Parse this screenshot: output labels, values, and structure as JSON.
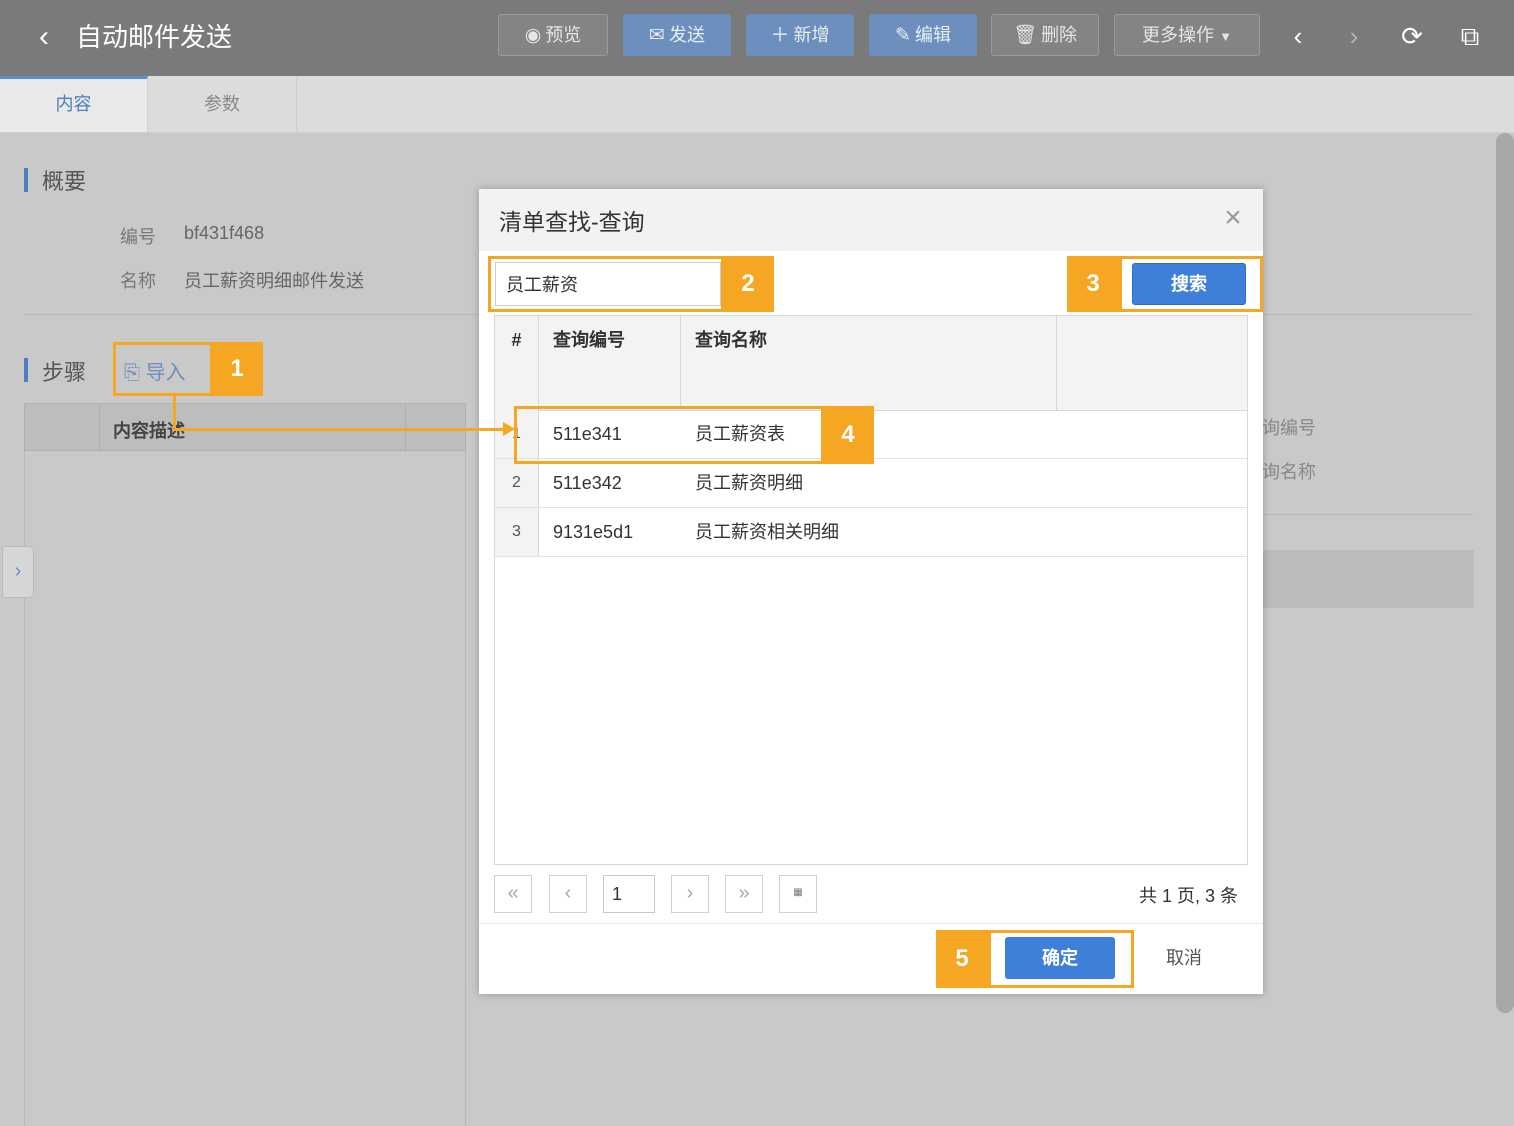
{
  "header": {
    "title": "自动邮件发送",
    "buttons": {
      "preview": "预览",
      "send": "发送",
      "add": "新增",
      "edit": "编辑",
      "delete": "删除",
      "more": "更多操作"
    }
  },
  "tabs": [
    "内容",
    "参数"
  ],
  "overview": {
    "section_title": "概要",
    "fields": [
      {
        "label": "编号",
        "value": "bf431f468"
      },
      {
        "label": "名称",
        "value": "员工薪资明细邮件发送"
      }
    ]
  },
  "steps": {
    "section_title": "步骤",
    "import_label": "导入",
    "table_header": "内容描述"
  },
  "right_labels": [
    "询编号",
    "询名称"
  ],
  "dialog": {
    "title": "清单查找-查询",
    "search_value": "员工薪资",
    "search_button": "搜索",
    "columns": [
      "#",
      "查询编号",
      "查询名称"
    ],
    "rows": [
      {
        "index": "1",
        "code": "511e341",
        "name": "员工薪资表"
      },
      {
        "index": "2",
        "code": "511e342",
        "name": "员工薪资明细"
      },
      {
        "index": "3",
        "code": "9131e5d1",
        "name": "员工薪资相关明细"
      }
    ],
    "pagination": {
      "current_page": "1",
      "summary": "共 1 页, 3 条"
    },
    "confirm_button": "确定",
    "cancel_button": "取消"
  },
  "callouts": [
    "1",
    "2",
    "3",
    "4",
    "5"
  ],
  "colors": {
    "header_bg": "#7a7a7a",
    "accent_blue": "#3d7fd9",
    "callout_orange": "#f5a623"
  }
}
